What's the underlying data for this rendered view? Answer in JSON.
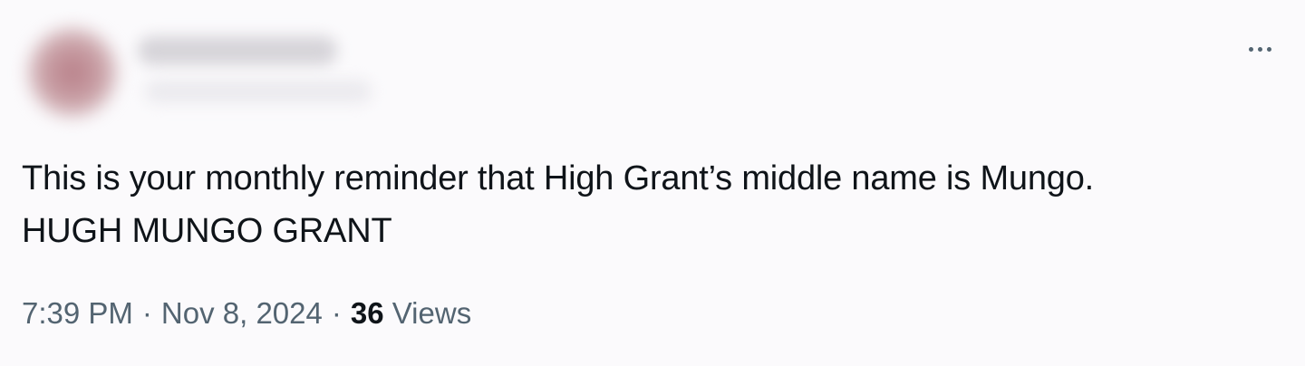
{
  "author": {
    "name": "",
    "handle": ""
  },
  "tweet": {
    "lines": [
      "This is your monthly reminder that High Grant’s middle name is Mungo.",
      "HUGH MUNGO GRANT"
    ]
  },
  "meta": {
    "time": "7:39 PM",
    "date": "Nov 8, 2024",
    "separator": "·",
    "views_count": "36",
    "views_label": "Views"
  },
  "icons": {
    "more": "more-horizontal-icon"
  },
  "colors": {
    "background": "#fbfafc",
    "text_primary": "#0f1419",
    "text_secondary": "#536471"
  }
}
